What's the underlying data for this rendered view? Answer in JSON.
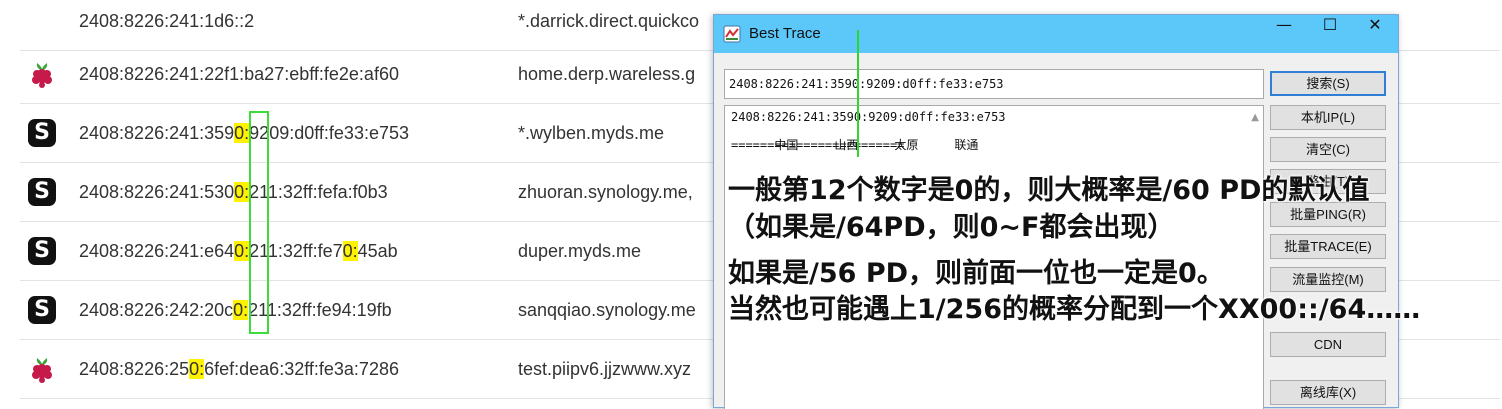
{
  "list": {
    "rows": [
      {
        "icon": "none",
        "ip_parts": [
          "2408:8226:241:1d6::2"
        ],
        "hl": [],
        "host": "*.darrick.direct.quickco"
      },
      {
        "icon": "raspberry",
        "ip_parts": [
          "2408:8226:241:22f1:ba27:ebff:fe2e:af60"
        ],
        "hl": [],
        "host": "home.derp.wareless.g"
      },
      {
        "icon": "synology",
        "ip_parts": [
          "2408:8226:241:359",
          "0:",
          "9209:d0ff:fe33:e753"
        ],
        "hl": [
          1
        ],
        "host": "*.wylben.myds.me"
      },
      {
        "icon": "synology",
        "ip_parts": [
          "2408:8226:241:530",
          "0:",
          "211:32ff:fefa:f0b3"
        ],
        "hl": [
          1
        ],
        "host": "zhuoran.synology.me,"
      },
      {
        "icon": "synology",
        "ip_parts": [
          "2408:8226:241:e64",
          "0:",
          "211:32ff:fe7",
          "0:",
          "45ab"
        ],
        "hl": [
          1,
          3
        ],
        "host": "duper.myds.me"
      },
      {
        "icon": "synology",
        "ip_parts": [
          "2408:8226:242:20c",
          "0:",
          "211:32ff:fe94:19fb"
        ],
        "hl": [
          1
        ],
        "host": "sanqqiao.synology.me"
      },
      {
        "icon": "raspberry",
        "ip_parts": [
          "2408:8226:25",
          "0:",
          "6fef:dea6:32ff:fe3a:7286"
        ],
        "hl": [
          1
        ],
        "host": "test.piipv6.jjzwww.xyz"
      }
    ],
    "synology_glyph": "S"
  },
  "window": {
    "title": "Best Trace",
    "minimize": "—",
    "maximize": "☐",
    "close": "✕",
    "input_value": "2408:8226:241:3590:9209:d0ff:fe33:e753",
    "result": {
      "line1": "2408:8226:241:3590:9209:d0ff:fe33:e753",
      "loc": [
        "中国",
        "山西",
        "太原",
        "联通"
      ],
      "separator": "========================"
    },
    "buttons": {
      "search": "搜索(S)",
      "local_ip": "本机IP(L)",
      "clear": "清空(C)",
      "route": "路由(T)",
      "batch_ping": "批量PING(R)",
      "batch_trace": "批量TRACE(E)",
      "traffic": "流量监控(M)",
      "cdn": "CDN",
      "offline": "离线库(X)"
    }
  },
  "annotation": {
    "line1": "一般第12个数字是0的，则大概率是/60 PD的默认值",
    "line2": "（如果是/64PD，则0~F都会出现）",
    "line3": "如果是/56 PD，则前面一位也一定是0。",
    "line4": "当然也可能遇上1/256的概率分配到一个XX00::/64……"
  },
  "colors": {
    "titlebar": "#5cc8fa",
    "highlight": "#fff200",
    "green_marker": "#3ddc3d",
    "primary_border": "#2f7fd6"
  }
}
